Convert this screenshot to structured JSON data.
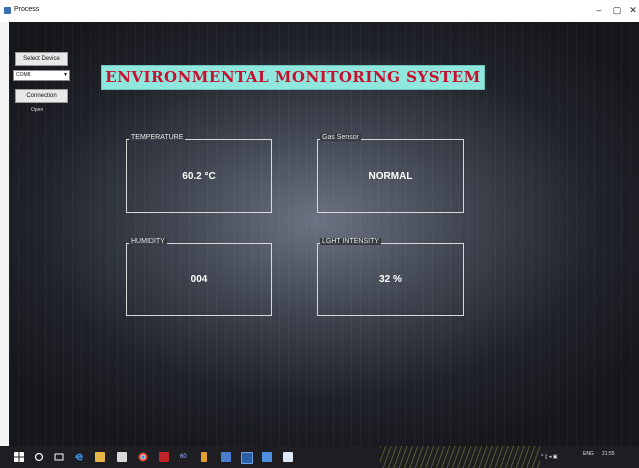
{
  "window": {
    "title": "Process",
    "controls": {
      "minimize": "–",
      "maximize": "▢",
      "close": "✕"
    }
  },
  "sidebar": {
    "select_device_label": "Select Device",
    "port_value": "COM8",
    "connection_label": "Connection",
    "status_text": "Open"
  },
  "banner": {
    "title": "ENVIRONMENTAL MONITORING SYSTEM"
  },
  "panels": {
    "temperature": {
      "legend": "TEMPERATURE",
      "value": "60.2 °C"
    },
    "gas": {
      "legend": "Gas Sensor",
      "value": "NORMAL"
    },
    "humidity": {
      "legend": "HUMIDITY",
      "value": "004"
    },
    "light": {
      "legend": "LGHT INTENSITY",
      "value": "32 %"
    }
  },
  "colors": {
    "banner_bg": "#8fe7dd",
    "banner_text": "#c8102e",
    "panel_border": "#d8d8d8",
    "value_text": "#ffffff"
  },
  "taskbar": {
    "icons": [
      "windows-start-icon",
      "search-icon",
      "task-view-icon",
      "edge-icon",
      "file-explorer-icon",
      "store-icon",
      "chrome-icon",
      "mail-icon",
      "app-icon",
      "app-icon",
      "app-icon",
      "app-icon",
      "app-icon",
      "app-icon"
    ],
    "language": "ENG",
    "time": "21:55"
  }
}
